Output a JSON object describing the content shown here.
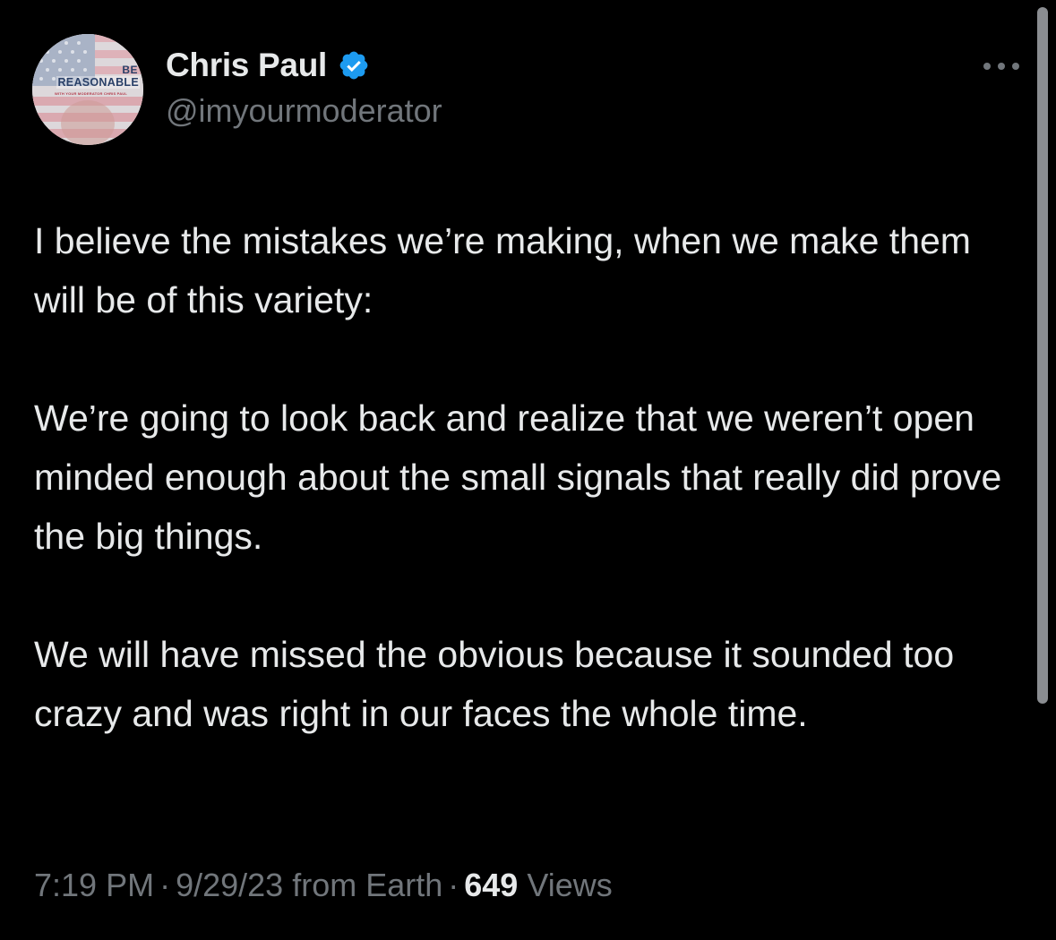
{
  "tweet": {
    "author": {
      "display_name": "Chris Paul",
      "handle": "@imyourmoderator",
      "verified": true,
      "avatar_icon": "flag-avatar",
      "avatar_text": {
        "line1": "BE",
        "line2": "REASONABLE",
        "line3": "WITH YOUR MODERATOR CHRIS PAUL"
      }
    },
    "paragraphs": [
      "I believe the mistakes we’re making, when we make them will be of this variety:",
      "We’re going to look back and realize that we weren’t open minded enough about the small signals that really did prove the big things.",
      "We will have missed the obvious because it sounded too crazy and was right in our faces the whole time."
    ],
    "meta": {
      "time": "7:19 PM",
      "separator": "·",
      "date": "9/29/23",
      "source": "from Earth",
      "views_count": "649",
      "views_label": "Views"
    }
  },
  "icons": {
    "verified": "verified-badge-icon",
    "more": "more-options-icon"
  },
  "colors": {
    "background": "#000000",
    "primary_text": "#e7e9ea",
    "secondary_text": "#71767b",
    "verified_blue": "#1d9bf0"
  }
}
